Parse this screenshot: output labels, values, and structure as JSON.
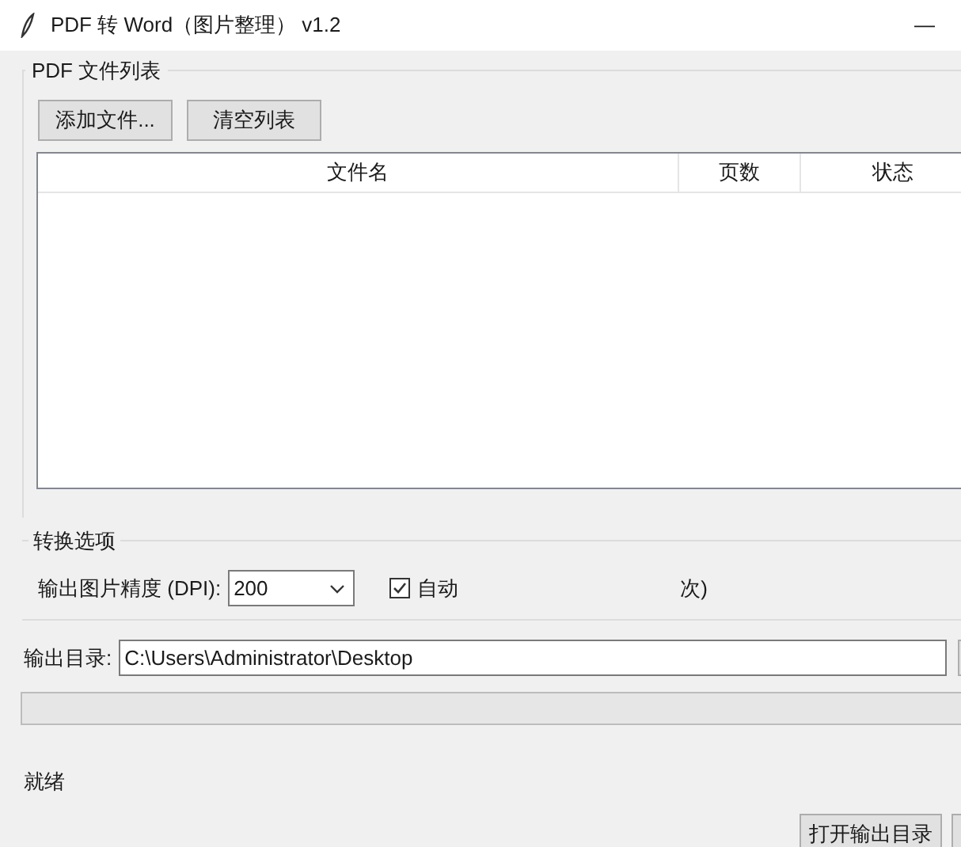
{
  "window": {
    "title": "PDF 转 Word（图片整理） v1.2",
    "controls": [
      "—"
    ]
  },
  "file_list": {
    "title": "PDF 文件列表",
    "buttons": [
      "添加文件...",
      "清空列表"
    ],
    "columns": [
      "文件名",
      "页数",
      "状态"
    ]
  },
  "options": {
    "title": "转换选项",
    "dpi_label": "输出图片精度 (DPI):",
    "dpi_value": "200",
    "checkbox": {
      "label": "自动",
      "checked": true,
      "label_tail": "次)"
    }
  },
  "output": {
    "label": "输出目录:",
    "value": "C:\\Users\\Administrator\\Desktop",
    "progress": {
      "level": 0
    }
  },
  "status": "就绪",
  "buttons": [
    "打开输出目录"
  ]
}
